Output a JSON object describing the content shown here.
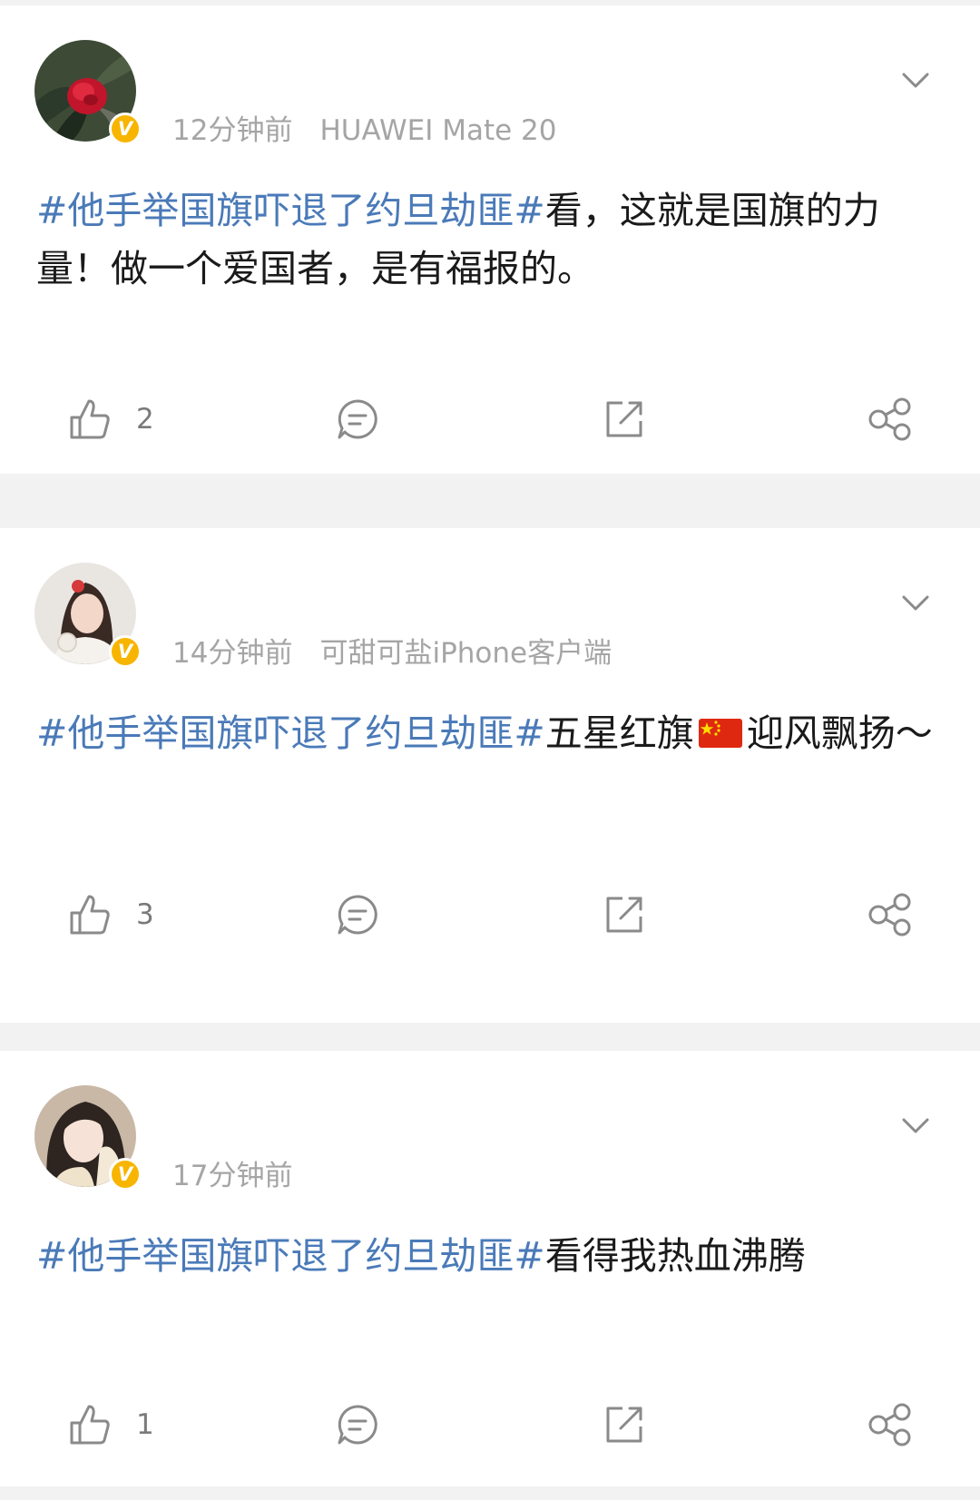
{
  "colors": {
    "hashtag": "#4a7ab8",
    "text": "#1a1a1a",
    "meta": "#a5a5a5",
    "verified_badge": "#f7b500",
    "icon": "#8a8a8a"
  },
  "posts": [
    {
      "time": "12分钟前",
      "source": "HUAWEI Mate 20",
      "hashtag": "#他手举国旗吓退了约旦劫匪#",
      "text_before_flag": "看，这就是国旗的力量！做一个爱国者，是有福报的。",
      "text_after_flag": "",
      "has_flag": false,
      "likes": "2",
      "avatar_icon": "red-camellia-avatar",
      "verified": true,
      "verified_mark": "V"
    },
    {
      "time": "14分钟前",
      "source": "可甜可盐iPhone客户端",
      "hashtag": "#他手举国旗吓退了约旦劫匪#",
      "text_before_flag": "五星红旗",
      "text_after_flag": "迎风飘扬～",
      "has_flag": true,
      "likes": "3",
      "avatar_icon": "girl-portrait-avatar",
      "verified": true,
      "verified_mark": "V"
    },
    {
      "time": "17分钟前",
      "source": "",
      "hashtag": "#他手举国旗吓退了约旦劫匪#",
      "text_before_flag": "看得我热血沸腾",
      "text_after_flag": "",
      "has_flag": false,
      "likes": "1",
      "avatar_icon": "girl-portrait-avatar",
      "verified": true,
      "verified_mark": "V"
    }
  ]
}
